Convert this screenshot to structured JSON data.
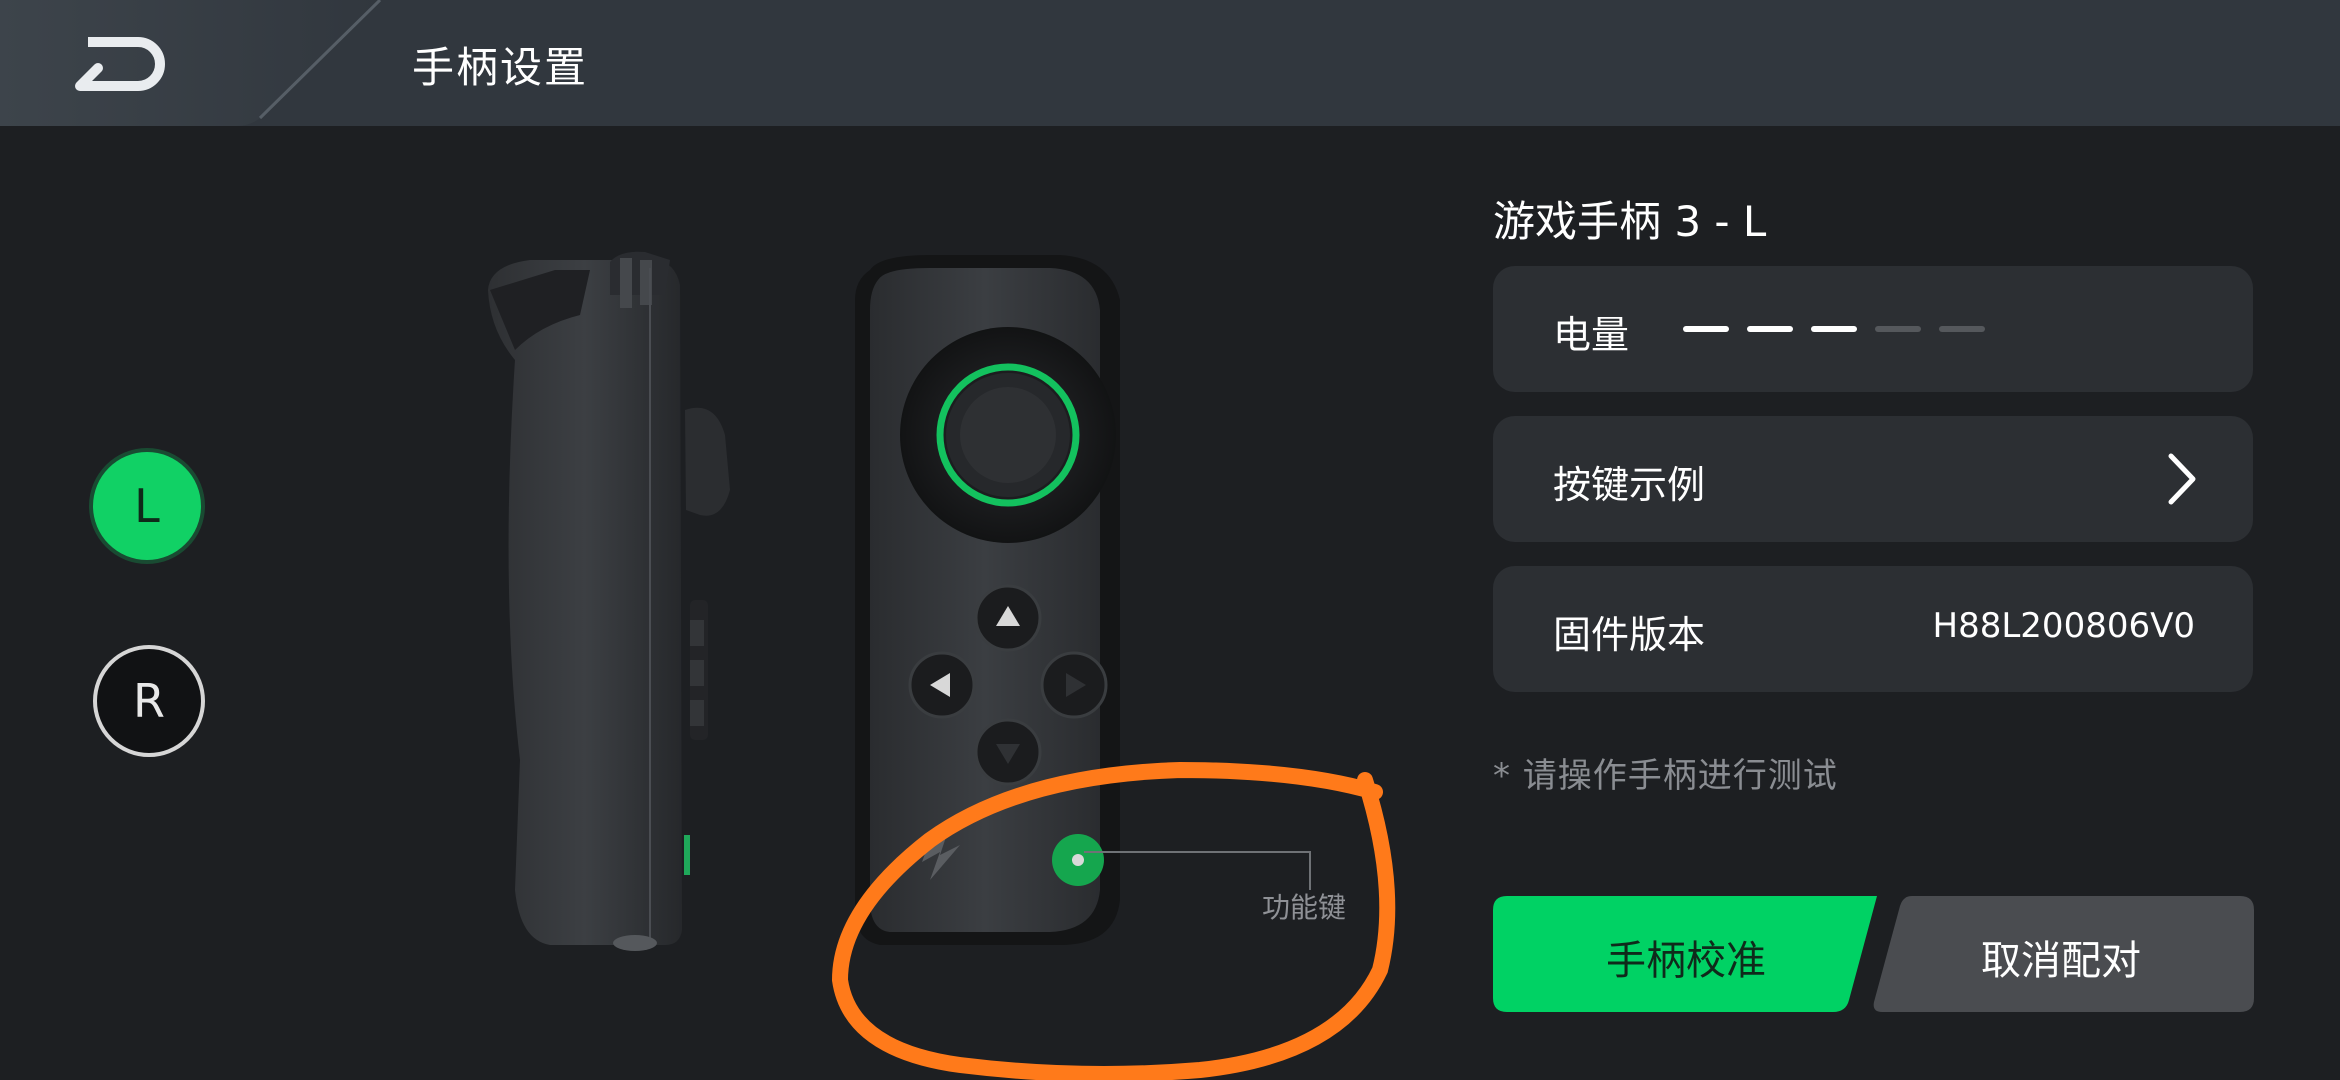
{
  "header": {
    "title": "手柄设置",
    "back_icon": "back-arrow-icon"
  },
  "side_tabs": {
    "left": "L",
    "right": "R"
  },
  "controller": {
    "function_key_label": "功能键"
  },
  "device": {
    "name": "游戏手柄 3 - L"
  },
  "cards": {
    "battery": {
      "label": "电量",
      "level": 0.6,
      "segments_total": 5,
      "segments_filled": 3
    },
    "key_example": {
      "label": "按键示例",
      "icon": "chevron-right-icon"
    },
    "firmware": {
      "label": "固件版本",
      "value": "H88L200806V0"
    }
  },
  "hint": "* 请操作手柄进行测试",
  "buttons": {
    "calibrate": "手柄校准",
    "unpair": "取消配对"
  },
  "colors": {
    "accent": "#00d264",
    "card": "#2c2f33",
    "header": "#31373e",
    "annotation": "#ff7a1a"
  }
}
